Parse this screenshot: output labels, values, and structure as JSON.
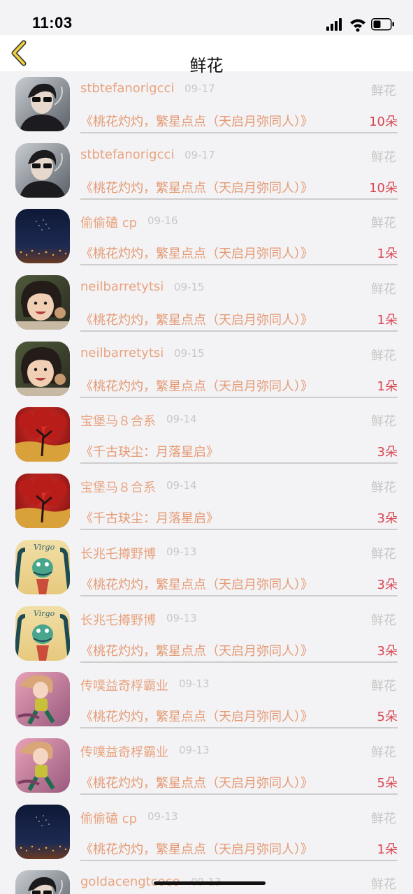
{
  "status": {
    "time": "11:03"
  },
  "nav": {
    "title": "鲜花"
  },
  "colors": {
    "username": "#e9a37f",
    "book": "#e59a74",
    "count": "#d94552",
    "meta": "#c6c6c6"
  },
  "rows": [
    {
      "user": "stbtefanorigcci",
      "date": "09-17",
      "type": "鲜花",
      "book": "《桃花灼灼，繁星点点（天启月弥同人）》",
      "count": "10朵",
      "avatar": "smoker-photo"
    },
    {
      "user": "stbtefanorigcci",
      "date": "09-17",
      "type": "鲜花",
      "book": "《桃花灼灼，繁星点点（天启月弥同人）》",
      "count": "10朵",
      "avatar": "smoker-photo"
    },
    {
      "user": "偷偷磕 cp",
      "date": "09-16",
      "type": "鲜花",
      "book": "《桃花灼灼，繁星点点（天启月弥同人）》",
      "count": "1朵",
      "avatar": "night-sky"
    },
    {
      "user": "neilbarretytsi",
      "date": "09-15",
      "type": "鲜花",
      "book": "《桃花灼灼，繁星点点（天启月弥同人）》",
      "count": "1朵",
      "avatar": "child-photo"
    },
    {
      "user": "neilbarretytsi",
      "date": "09-15",
      "type": "鲜花",
      "book": "《桃花灼灼，繁星点点（天启月弥同人）》",
      "count": "1朵",
      "avatar": "child-photo"
    },
    {
      "user": "宝堡马８合系",
      "date": "09-14",
      "type": "鲜花",
      "book": "《千古玦尘：月落星启》",
      "count": "3朵",
      "avatar": "red-tree"
    },
    {
      "user": "宝堡马８合系",
      "date": "09-14",
      "type": "鲜花",
      "book": "《千古玦尘：月落星启》",
      "count": "3朵",
      "avatar": "red-tree"
    },
    {
      "user": "长兆乇撙野博",
      "date": "09-13",
      "type": "鲜花",
      "book": "《桃花灼灼，繁星点点（天启月弥同人）》",
      "count": "3朵",
      "avatar": "virgo-card"
    },
    {
      "user": "长兆乇撙野博",
      "date": "09-13",
      "type": "鲜花",
      "book": "《桃花灼灼，繁星点点（天启月弥同人）》",
      "count": "3朵",
      "avatar": "virgo-card"
    },
    {
      "user": "传噗益奇桴霸业",
      "date": "09-13",
      "type": "鲜花",
      "book": "《桃花灼灼，繁星点点（天启月弥同人）》",
      "count": "5朵",
      "avatar": "anime-girl"
    },
    {
      "user": "传噗益奇桴霸业",
      "date": "09-13",
      "type": "鲜花",
      "book": "《桃花灼灼，繁星点点（天启月弥同人）》",
      "count": "5朵",
      "avatar": "anime-girl"
    },
    {
      "user": "偷偷磕 cp",
      "date": "09-13",
      "type": "鲜花",
      "book": "《桃花灼灼，繁星点点（天启月弥同人）》",
      "count": "1朵",
      "avatar": "night-sky"
    },
    {
      "user": "goldacengtcoco",
      "date": "09-13",
      "type": "鲜花",
      "book": "",
      "count": "",
      "avatar": "smoker-photo"
    }
  ]
}
